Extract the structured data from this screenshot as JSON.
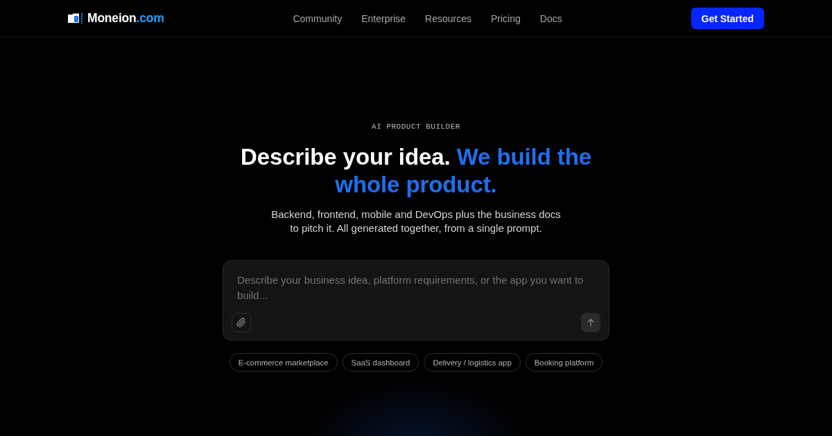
{
  "header": {
    "logo": {
      "name": "Moneion",
      "suffix": ".com"
    },
    "nav": [
      "Community",
      "Enterprise",
      "Resources",
      "Pricing",
      "Docs"
    ],
    "cta": "Get Started"
  },
  "hero": {
    "eyebrow": "AI PRODUCT BUILDER",
    "headline": {
      "lead": "Describe your idea.",
      "highlight": "We build the whole product."
    },
    "subtitle": "Backend, frontend, mobile and DevOps plus the business docs to pitch it. All generated together, from a single prompt."
  },
  "prompt": {
    "placeholder": "Describe your business idea, platform requirements, or the app you want to build..."
  },
  "suggestions": [
    "E-commerce marketplace",
    "SaaS dashboard",
    "Delivery / logistics app",
    "Booking platform"
  ]
}
